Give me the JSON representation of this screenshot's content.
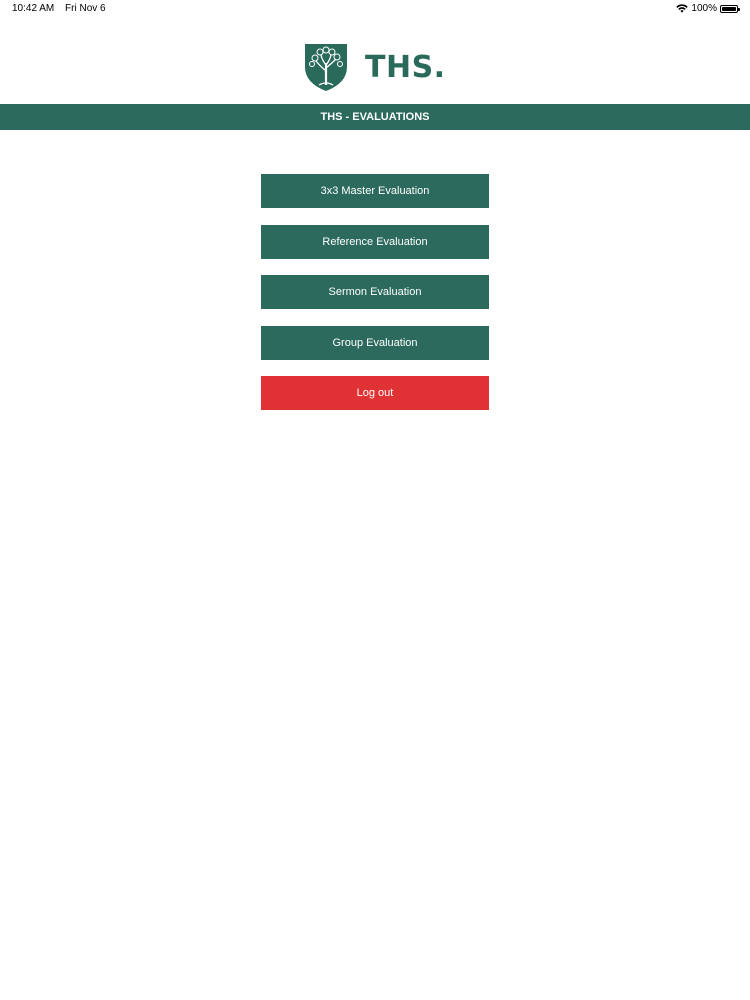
{
  "status_bar": {
    "time": "10:42 AM",
    "date": "Fri Nov 6",
    "battery": "100%"
  },
  "logo": {
    "wordmark": "THS."
  },
  "header": {
    "title": "THS - EVALUATIONS"
  },
  "menu": {
    "items": [
      {
        "label": "3x3 Master Evaluation"
      },
      {
        "label": "Reference Evaluation"
      },
      {
        "label": "Sermon Evaluation"
      },
      {
        "label": "Group Evaluation"
      }
    ],
    "logout_label": "Log out"
  },
  "colors": {
    "brand_green": "#2b6a5c",
    "logout_red": "#e03234"
  },
  "icons": [
    "wifi-icon",
    "battery-icon",
    "shield-tree-icon"
  ]
}
